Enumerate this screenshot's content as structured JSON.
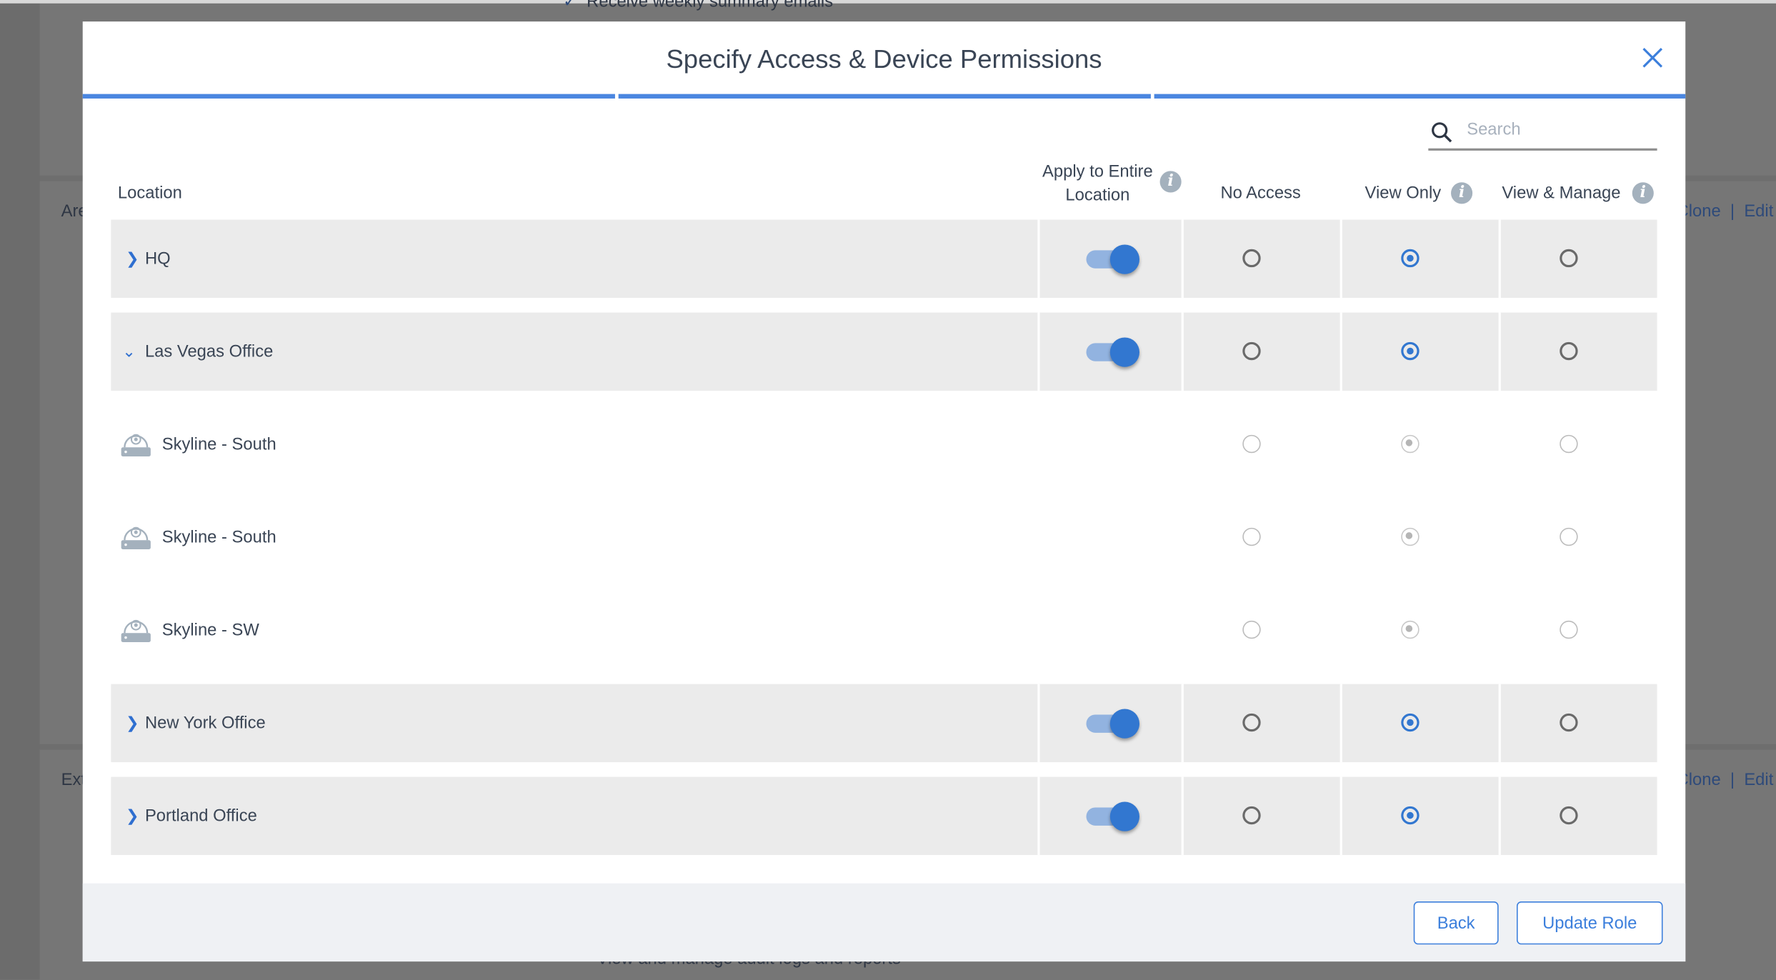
{
  "background": {
    "top_text": "Receive weekly summary emails",
    "section1_label": "Are",
    "section2_label": "Ext",
    "clone_label": "Clone",
    "edit_label": "Edit",
    "bottom_text": "View and manage audit logs and reports"
  },
  "modal": {
    "title": "Specify Access & Device Permissions",
    "progress_steps": 3,
    "progress_completed": 3,
    "search": {
      "placeholder": "Search",
      "value": ""
    },
    "columns": {
      "location": "Location",
      "apply_line1": "Apply to Entire",
      "apply_line2": "Location",
      "no_access": "No Access",
      "view_only": "View Only",
      "view_manage": "View & Manage"
    },
    "rows": [
      {
        "name": "HQ",
        "type": "location",
        "expanded": false,
        "apply_entire": true,
        "permission": "view_only"
      },
      {
        "name": "Las Vegas Office",
        "type": "location",
        "expanded": true,
        "apply_entire": true,
        "permission": "view_only"
      },
      {
        "name": "Skyline - South",
        "type": "device",
        "icon": "camera-icon",
        "permission": "view_only",
        "disabled": true
      },
      {
        "name": "Skyline - South",
        "type": "device",
        "icon": "camera-icon",
        "permission": "view_only",
        "disabled": true
      },
      {
        "name": "Skyline - SW",
        "type": "device",
        "icon": "camera-icon",
        "permission": "view_only",
        "disabled": true
      },
      {
        "name": "New York Office",
        "type": "location",
        "expanded": false,
        "apply_entire": true,
        "permission": "view_only"
      },
      {
        "name": "Portland Office",
        "type": "location",
        "expanded": false,
        "apply_entire": true,
        "permission": "view_only"
      }
    ],
    "footer": {
      "back_label": "Back",
      "update_label": "Update Role"
    }
  },
  "colors": {
    "accent": "#3277d0",
    "progress": "#4a86e0",
    "row_bg": "#ebebeb",
    "footer_bg": "#eff1f4"
  }
}
